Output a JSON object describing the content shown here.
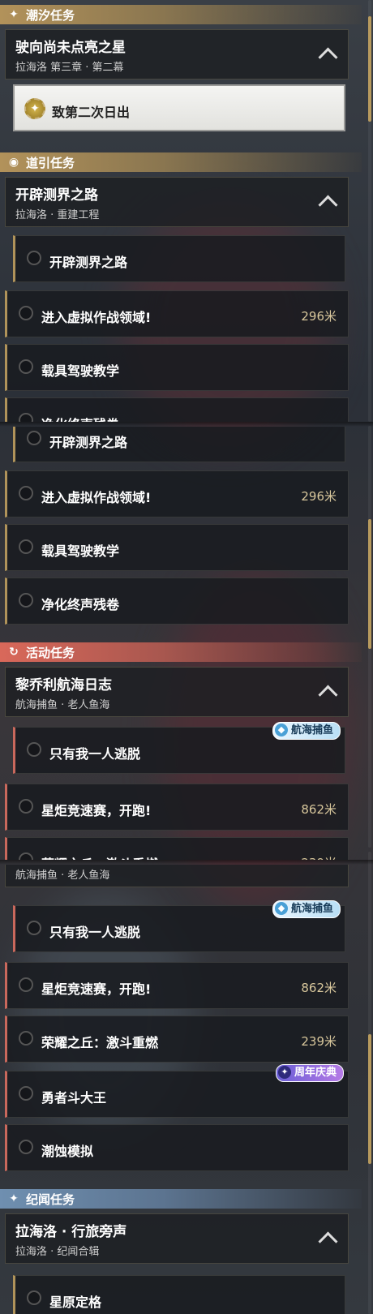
{
  "headers": {
    "tide": "潮汐任务",
    "guide": "道引任务",
    "event": "活动任务",
    "chronicle": "纪闻任务"
  },
  "quests": {
    "tide": {
      "title": "驶向尚未点亮之星",
      "sub": "拉海洛 第三章 · 第二幕"
    },
    "guide": {
      "title": "开辟测界之路",
      "sub": "拉海洛 · 重建工程"
    },
    "event": {
      "title": "黎乔利航海日志",
      "sub": "航海捕鱼 · 老人鱼海"
    },
    "chronicle": {
      "title": "拉海洛 · 行旅旁声",
      "sub": "拉海洛 · 纪闻合辑"
    }
  },
  "tasks": {
    "t_selected": "致第二次日出",
    "g1": "开辟测界之路",
    "g2": "进入虚拟作战领域!",
    "g2_dist": "296米",
    "g3": "载具驾驶教学",
    "g4": "净化终声残卷",
    "e1": "只有我一人逃脱",
    "e2": "星炬竞速赛，开跑!",
    "e2_dist": "862米",
    "e3": "荣耀之丘：激斗重燃",
    "e3_dist": "239米",
    "e4": "勇者斗大王",
    "e5": "潮蚀模拟",
    "c1": "星原定格"
  },
  "badges": {
    "fishing": "航海捕鱼",
    "anniversary": "周年庆典"
  },
  "colors": {
    "gold": "#b2925a",
    "red": "#d9685a",
    "blue": "#6f8fb0"
  }
}
